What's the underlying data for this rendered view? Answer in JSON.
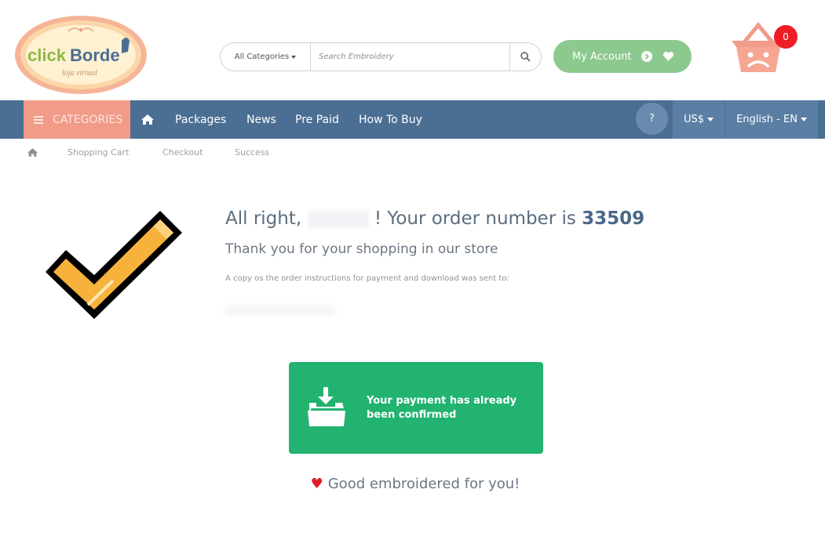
{
  "header": {
    "logo_text": "clickBorde",
    "logo_tagline": "loja virtual",
    "search": {
      "category_label": "All Categories",
      "placeholder": "Search Embroidery"
    },
    "account_label": "My Account",
    "cart_count": "0"
  },
  "navbar": {
    "categories_label": "CATEGORIES",
    "items": [
      {
        "label": "Packages"
      },
      {
        "label": "News"
      },
      {
        "label": "Pre Paid"
      },
      {
        "label": "How To Buy"
      }
    ],
    "help_label": "?",
    "currency_label": "US$",
    "language_label": "English - EN"
  },
  "breadcrumb": {
    "items": [
      "Shopping Cart",
      "Checkout",
      "Success"
    ]
  },
  "content": {
    "title_prefix": "All right,",
    "title_middle": "! Your order number is",
    "order_number": "33509",
    "subtitle": "Thank you for your shopping in our store",
    "copy_note": "A copy os the order instructions for payment and download was sent to:",
    "confirm_message": "Your payment has already been confirmed",
    "footer_message": "Good embroidered for you!"
  },
  "colors": {
    "nav_bg": "#4b6e93",
    "categories_bg": "#f19b88",
    "account_bg": "#8cc98f",
    "confirm_bg": "#21b36f",
    "badge_bg": "#ee1c25",
    "check_color": "#f7b23b"
  },
  "icons": [
    "search-icon",
    "home-icon",
    "menu-icon",
    "heart-icon",
    "arrow-circle-icon",
    "basket-icon",
    "checkmark-icon",
    "download-folder-icon"
  ]
}
